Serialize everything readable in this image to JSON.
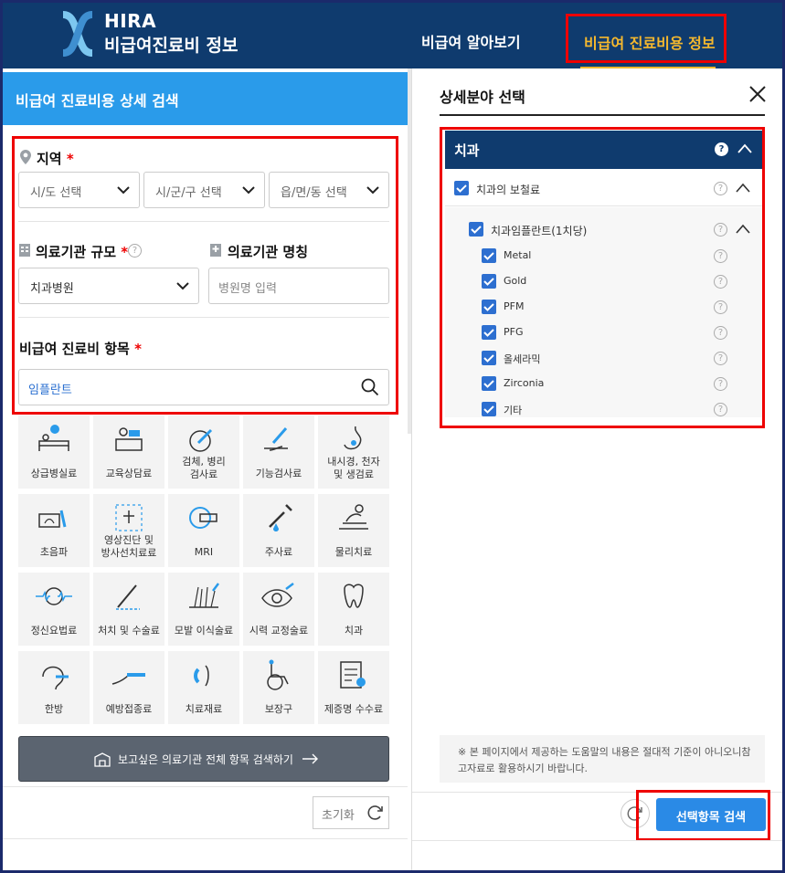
{
  "header": {
    "logo_line1": "HIRA",
    "logo_line2": "비급여진료비 정보",
    "nav": [
      "비급여 알아보기",
      "비급여 진료비용 정보"
    ]
  },
  "left": {
    "title": "비급여 진료비용 상세 검색",
    "region_label": "지역",
    "region_selects": [
      "시/도 선택",
      "시/군/구 선택",
      "읍/면/동 선택"
    ],
    "scale_label": "의료기관 규모",
    "scale_value": "치과병원",
    "name_label": "의료기관 명칭",
    "name_placeholder": "병원명 입력",
    "item_label": "비급여 진료비 항목",
    "item_value": "임플란트",
    "required_mark": "*",
    "categories": [
      [
        "상급병실료",
        "교육상담료",
        "검체, 병리\n검사료",
        "기능검사료",
        "내시경, 천자\n및 생검료"
      ],
      [
        "초음파",
        "영상진단 및\n방사선치료료",
        "MRI",
        "주사료",
        "물리치료"
      ],
      [
        "정신요법료",
        "처치 및 수술료",
        "모발 이식술료",
        "시력 교정술료",
        "치과"
      ],
      [
        "한방",
        "예방접종료",
        "치료재료",
        "보장구",
        "제증명 수수료"
      ]
    ],
    "search_all_label": "보고싶은 의료기관 전체 항목 검색하기",
    "reset_label": "초기화"
  },
  "right": {
    "title": "상세분야 선택",
    "category": "치과",
    "group": "치과의 보철료",
    "subgroup": "치과임플란트(1치당)",
    "items": [
      "Metal",
      "Gold",
      "PFM",
      "PFG",
      "올세라믹",
      "Zirconia",
      "기타"
    ],
    "notice": "※ 본 페이지에서 제공하는 도움말의 내용은 절대적 기준이 아니오니참고자료로 활용하시기 바랍니다.",
    "search_label": "선택항목 검색"
  },
  "colors": {
    "header_bg": "#0f3b6e",
    "accent_blue": "#2a9bea",
    "nav_active": "#f5b82e",
    "highlight_red": "#ee0000",
    "checkbox": "#2d6fd0"
  }
}
